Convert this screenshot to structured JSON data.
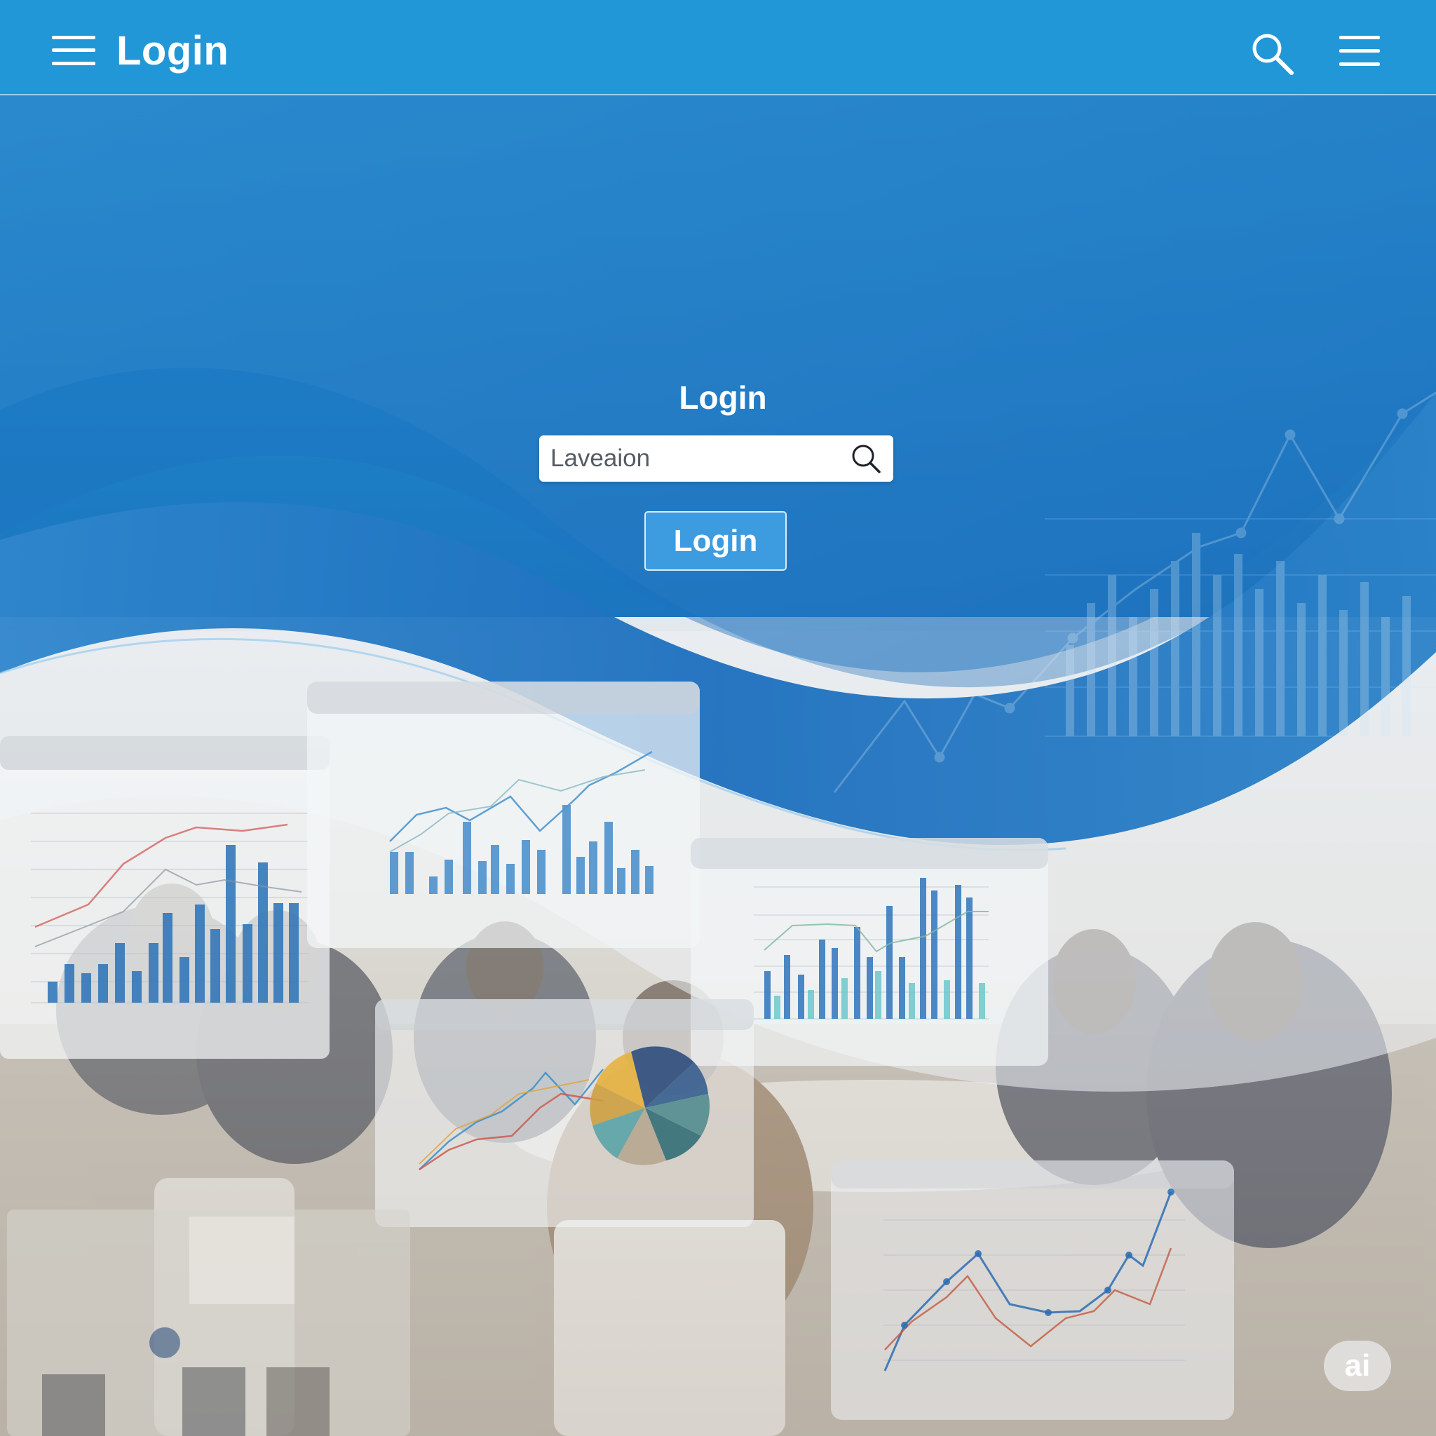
{
  "header": {
    "title": "Login",
    "menu_icon": "hamburger-menu-icon",
    "search_icon": "search-icon",
    "right_menu_icon": "hamburger-menu-icon"
  },
  "login_form": {
    "heading": "Login",
    "input_value": "Laveaion",
    "input_icon": "search-icon",
    "button_label": "Login"
  },
  "watermark": {
    "text": "ai"
  },
  "colors": {
    "header_blue": "#2197d7",
    "accent_blue": "#3d9be0",
    "deep_blue": "#1b63ad"
  }
}
